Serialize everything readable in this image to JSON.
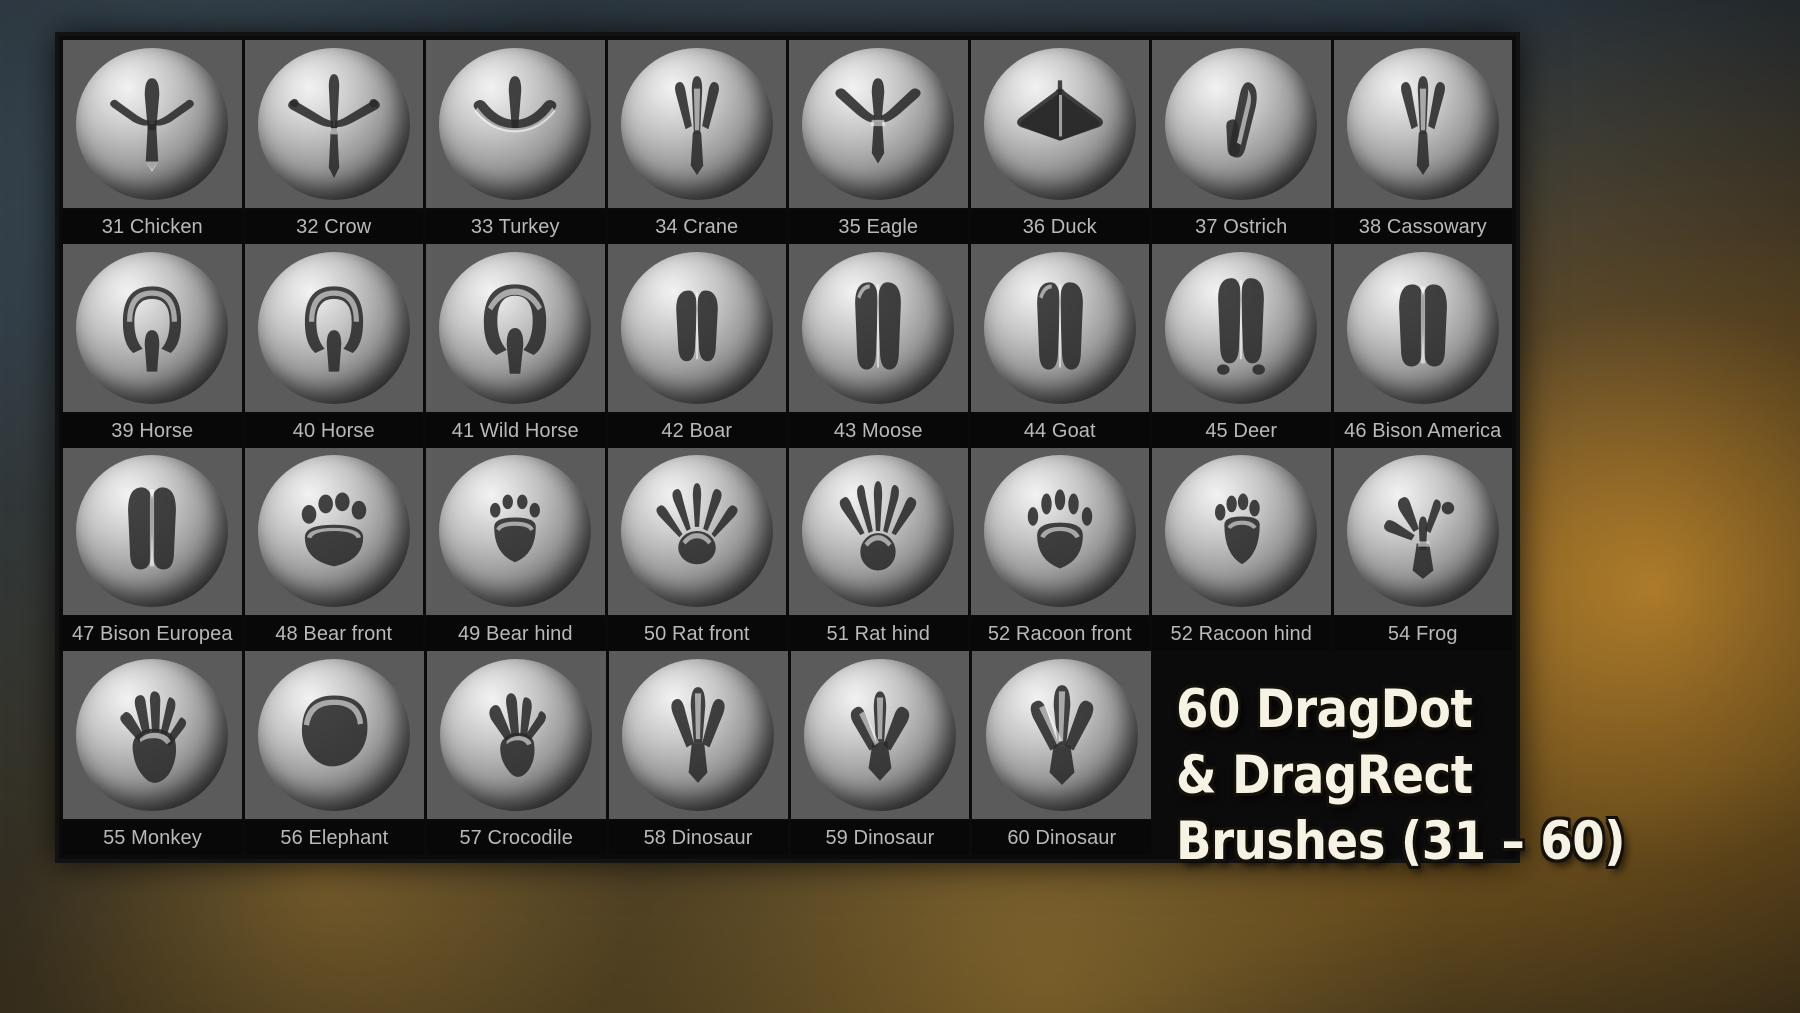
{
  "background": {
    "description": "blurred photographic backdrop",
    "colors": {
      "top_left": "#46565f",
      "bottom_right": "#6a5326",
      "glow": "#d69630"
    }
  },
  "panel": {
    "frame_color": "#0b0b0b",
    "cell_bg": "#5b5b5b",
    "caption_bg": "#080808",
    "caption_color": "#b9b9b9",
    "columns": 8,
    "rows": 4
  },
  "rows": [
    {
      "cells": [
        {
          "label": "31 Chicken",
          "icon": "chicken-footprint-icon",
          "shape": "bird3"
        },
        {
          "label": "32 Crow",
          "icon": "crow-footprint-icon",
          "shape": "bird4"
        },
        {
          "label": "33 Turkey",
          "icon": "turkey-footprint-icon",
          "shape": "birdWide"
        },
        {
          "label": "34 Crane",
          "icon": "crane-footprint-icon",
          "shape": "bird3slim"
        },
        {
          "label": "35 Eagle",
          "icon": "eagle-footprint-icon",
          "shape": "raptor"
        },
        {
          "label": "36 Duck",
          "icon": "duck-footprint-icon",
          "shape": "webbed"
        },
        {
          "label": "37 Ostrich",
          "icon": "ostrich-footprint-icon",
          "shape": "ostrich"
        },
        {
          "label": "38 Cassowary",
          "icon": "cassowary-footprint-icon",
          "shape": "bird3slim"
        }
      ]
    },
    {
      "cells": [
        {
          "label": "39 Horse",
          "icon": "horse-hoof-icon",
          "shape": "hoofU"
        },
        {
          "label": "40 Horse",
          "icon": "horse-hoof-icon",
          "shape": "hoofU"
        },
        {
          "label": "41 Wild Horse",
          "icon": "wild-horse-hoof-icon",
          "shape": "hoofRough"
        },
        {
          "label": "42 Boar",
          "icon": "boar-hoof-icon",
          "shape": "cloven"
        },
        {
          "label": "43 Moose",
          "icon": "moose-hoof-icon",
          "shape": "clovenTall"
        },
        {
          "label": "44 Goat",
          "icon": "goat-hoof-icon",
          "shape": "clovenTall"
        },
        {
          "label": "45 Deer",
          "icon": "deer-hoof-icon",
          "shape": "clovenDew"
        },
        {
          "label": "46 Bison America",
          "icon": "bison-hoof-icon",
          "shape": "clovenWide"
        }
      ]
    },
    {
      "cells": [
        {
          "label": "47 Bison Europea",
          "icon": "bison-europe-hoof-icon",
          "shape": "clovenWide"
        },
        {
          "label": "48 Bear front",
          "icon": "bear-front-paw-icon",
          "shape": "paw5"
        },
        {
          "label": "49 Bear hind",
          "icon": "bear-hind-paw-icon",
          "shape": "paw5small"
        },
        {
          "label": "50 Rat front",
          "icon": "rat-front-paw-icon",
          "shape": "claw5"
        },
        {
          "label": "51 Rat hind",
          "icon": "rat-hind-paw-icon",
          "shape": "claw5long"
        },
        {
          "label": "52 Racoon front",
          "icon": "racoon-front-paw-icon",
          "shape": "racoon"
        },
        {
          "label": "52 Racoon hind",
          "icon": "racoon-hind-paw-icon",
          "shape": "racoonHind"
        },
        {
          "label": "54 Frog",
          "icon": "frog-footprint-icon",
          "shape": "frog"
        }
      ]
    },
    {
      "cells": [
        {
          "label": "55 Monkey",
          "icon": "monkey-handprint-icon",
          "shape": "hand"
        },
        {
          "label": "56 Elephant",
          "icon": "elephant-footprint-icon",
          "shape": "blob"
        },
        {
          "label": "57 Crocodile",
          "icon": "crocodile-footprint-icon",
          "shape": "croc"
        },
        {
          "label": "58 Dinosaur",
          "icon": "dinosaur-footprint-icon",
          "shape": "dino3"
        },
        {
          "label": "59 Dinosaur",
          "icon": "dinosaur-footprint-icon",
          "shape": "dino3b"
        },
        {
          "label": "60 Dinosaur",
          "icon": "dinosaur-footprint-icon",
          "shape": "dino3c"
        }
      ]
    }
  ],
  "title": {
    "line1": "60 DragDot",
    "line2": "& DragRect",
    "line3": "Brushes (31 – 60)",
    "text_color": "#f6f2e4",
    "outline_color": "#14100a"
  }
}
